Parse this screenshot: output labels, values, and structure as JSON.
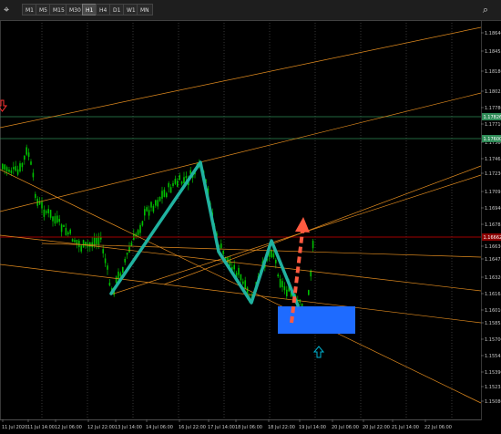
{
  "toolbar": {
    "timeframes": [
      "M1",
      "M5",
      "M15",
      "M30",
      "H1",
      "H4",
      "D1",
      "W1",
      "MN"
    ],
    "active": "H1",
    "left_icon": "crosshair-icon",
    "right_icon": "search-icon"
  },
  "price_axis": {
    "labels": [
      "1.18640",
      "1.18455",
      "1.18180",
      "1.18025",
      "1.17780",
      "1.17710",
      "1.17560",
      "1.17465",
      "1.17230",
      "1.17095",
      "1.16940",
      "1.16785",
      "1.16630",
      "1.16475",
      "1.16320",
      "1.16165",
      "1.16010",
      "1.15855",
      "1.15700",
      "1.15545",
      "1.15390",
      "1.15235",
      "1.15080"
    ],
    "badges": [
      {
        "text": "1.17826",
        "color": "#2e8b57"
      },
      {
        "text": "1.17600",
        "color": "#2e8b57"
      },
      {
        "text": "1.16662",
        "color": "#8b0000"
      }
    ]
  },
  "time_axis": {
    "labels": [
      "11 Jul 2020",
      "11 Jul 14:00",
      "12 Jul 06:00",
      "12 Jul 22:00",
      "13 Jul 14:00",
      "14 Jul 06:00",
      "16 Jul 22:00",
      "17 Jul 14:00",
      "18 Jul 06:00",
      "18 Jul 22:00",
      "19 Jul 14:00",
      "20 Jul 06:00",
      "20 Jul 22:00",
      "21 Jul 14:00",
      "22 Jul 06:00"
    ]
  },
  "colors": {
    "candles": "#00c000",
    "trendlines": "#e08a1e",
    "horizontal_green": "#2e8b57",
    "horizontal_red": "#a00000",
    "pattern": "#20b2a0",
    "arrow_dashed": "#ff5a40",
    "zone": "#1e6bff",
    "signal_up": "#00b4d2",
    "signal_down": "#ff3030"
  },
  "annotations": {
    "down_arrow": "red-down-arrow-icon",
    "up_arrow": "cyan-up-arrow-icon"
  }
}
